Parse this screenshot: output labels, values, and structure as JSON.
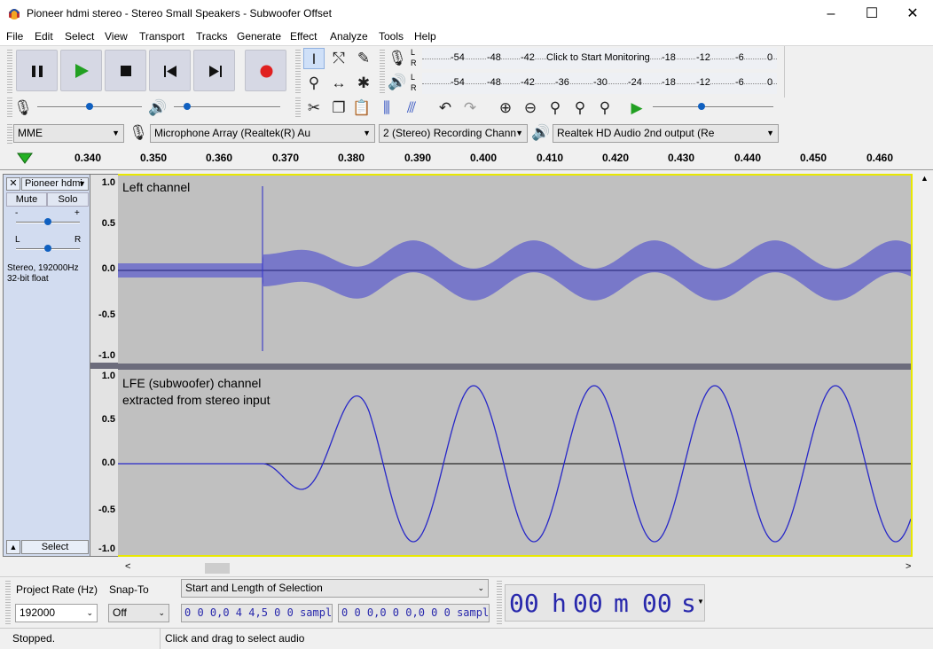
{
  "window": {
    "title": "Pioneer hdmi stereo - Stereo Small Speakers - Subwoofer Offset",
    "minimize": "–",
    "maximize": "☐",
    "close": "✕"
  },
  "menu": [
    "File",
    "Edit",
    "Select",
    "View",
    "Transport",
    "Tracks",
    "Generate",
    "Effect",
    "Analyze",
    "Tools",
    "Help"
  ],
  "transport": {
    "pause": "pause",
    "play": "play",
    "stop": "stop",
    "skip_start": "skip-to-start",
    "skip_end": "skip-to-end",
    "record": "record"
  },
  "colors": {
    "record": "#e02020",
    "play": "#20a020",
    "wave": "#2828c8",
    "selection_border": "#e8e800"
  },
  "meters": {
    "record": {
      "lr": "L\nR",
      "ticks": [
        "-54",
        "-48",
        "-42",
        "Click to Start Monitoring",
        "-18",
        "-12",
        "-6",
        "0"
      ]
    },
    "playback": {
      "lr": "L\nR",
      "ticks": [
        "-54",
        "-48",
        "-42",
        "-36",
        "-30",
        "-24",
        "-18",
        "-12",
        "-6",
        "0"
      ]
    }
  },
  "mixer": {
    "record_level": 0.5,
    "playback_level": 0.1,
    "play_speed": 0.4
  },
  "device": {
    "host": "MME",
    "input": "Microphone Array (Realtek(R) Au",
    "channels": "2 (Stereo) Recording Chann",
    "output": "Realtek HD Audio 2nd output (Re"
  },
  "ruler": {
    "ticks": [
      "0.340",
      "0.350",
      "0.360",
      "0.370",
      "0.380",
      "0.390",
      "0.400",
      "0.410",
      "0.420",
      "0.430",
      "0.440",
      "0.450",
      "0.460"
    ]
  },
  "track": {
    "name": "Pioneer hdmi",
    "close": "✕",
    "menu_arrow": "▼",
    "mute": "Mute",
    "solo": "Solo",
    "gain_minus": "-",
    "gain_plus": "+",
    "pan_left": "L",
    "pan_right": "R",
    "gain_level": 0.5,
    "pan_level": 0.5,
    "info1": "Stereo, 192000Hz",
    "info2": "32-bit float",
    "collapse": "▲",
    "select": "Select",
    "channels": [
      {
        "label": "Left channel",
        "label2": "",
        "vticks": [
          "1.0",
          "0.5",
          "0.0",
          "-0.5",
          "-1.0"
        ]
      },
      {
        "label": "LFE (subwoofer) channel",
        "label2": "extracted from stereo input",
        "vticks": [
          "1.0",
          "0.5",
          "0.0",
          "-0.5",
          "-1.0"
        ]
      }
    ]
  },
  "selection_bar": {
    "rate_label": "Project Rate (Hz)",
    "rate_value": "192000",
    "snap_label": "Snap-To",
    "snap_value": "Off",
    "mode": "Start and Length of Selection",
    "start_value": "0 0 0,0 4 4,5 0 0",
    "start_unit": "samples",
    "length_value": "0 0 0,0 0 0,0 0 0",
    "length_unit": "samples",
    "time_h": "00",
    "h": "h",
    "time_m": "00",
    "m": "m",
    "time_s": "00",
    "s": "s"
  },
  "status": {
    "left": "Stopped.",
    "right": "Click and drag to select audio"
  }
}
